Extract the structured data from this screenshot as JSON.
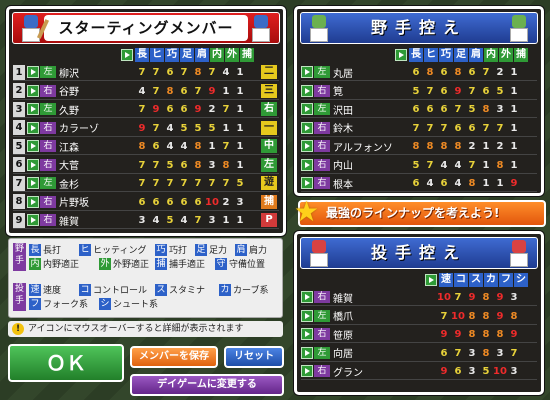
{
  "starting": {
    "title": "スターティングメンバー",
    "categories": [
      "長",
      "ヒ",
      "巧",
      "足",
      "肩",
      "内",
      "外",
      "捕"
    ],
    "players": [
      {
        "num": "1",
        "hand": "左",
        "name": "柳沢",
        "stats": [
          "7",
          "7",
          "6",
          "7",
          "8",
          "7",
          "4",
          "1"
        ],
        "pos": "二"
      },
      {
        "num": "2",
        "hand": "右",
        "name": "谷野",
        "stats": [
          "4",
          "7",
          "8",
          "6",
          "7",
          "9",
          "1",
          "1"
        ],
        "pos": "三"
      },
      {
        "num": "3",
        "hand": "左",
        "name": "久野",
        "stats": [
          "7",
          "9",
          "6",
          "6",
          "9",
          "2",
          "7",
          "1"
        ],
        "pos": "右"
      },
      {
        "num": "4",
        "hand": "右",
        "name": "カラーゾ",
        "stats": [
          "9",
          "7",
          "4",
          "5",
          "5",
          "5",
          "1",
          "1"
        ],
        "pos": "一"
      },
      {
        "num": "5",
        "hand": "右",
        "name": "江森",
        "stats": [
          "8",
          "6",
          "4",
          "4",
          "8",
          "1",
          "7",
          "1"
        ],
        "pos": "中"
      },
      {
        "num": "6",
        "hand": "右",
        "name": "大菅",
        "stats": [
          "7",
          "7",
          "5",
          "6",
          "8",
          "3",
          "8",
          "1"
        ],
        "pos": "左"
      },
      {
        "num": "7",
        "hand": "左",
        "name": "金杉",
        "stats": [
          "7",
          "7",
          "7",
          "7",
          "7",
          "7",
          "7",
          "5"
        ],
        "pos": "遊"
      },
      {
        "num": "8",
        "hand": "右",
        "name": "片野坂",
        "stats": [
          "6",
          "6",
          "6",
          "6",
          "6",
          "10",
          "2",
          "3"
        ],
        "pos": "捕"
      },
      {
        "num": "9",
        "hand": "右",
        "name": "雑賀",
        "stats": [
          "3",
          "4",
          "5",
          "4",
          "7",
          "3",
          "1",
          "1"
        ],
        "pos": "P"
      }
    ]
  },
  "bench": {
    "title": "野手控え",
    "categories": [
      "長",
      "ヒ",
      "巧",
      "足",
      "肩",
      "内",
      "外",
      "捕"
    ],
    "players": [
      {
        "hand": "左",
        "name": "丸居",
        "stats": [
          "6",
          "8",
          "6",
          "8",
          "6",
          "7",
          "2",
          "1"
        ]
      },
      {
        "hand": "右",
        "name": "筧",
        "stats": [
          "5",
          "7",
          "6",
          "9",
          "7",
          "6",
          "5",
          "1"
        ]
      },
      {
        "hand": "左",
        "name": "沢田",
        "stats": [
          "6",
          "6",
          "6",
          "7",
          "5",
          "8",
          "3",
          "1"
        ]
      },
      {
        "hand": "右",
        "name": "鈴木",
        "stats": [
          "7",
          "7",
          "7",
          "6",
          "6",
          "7",
          "7",
          "1"
        ]
      },
      {
        "hand": "右",
        "name": "アルフォンソ",
        "stats": [
          "8",
          "8",
          "8",
          "8",
          "2",
          "1",
          "2",
          "1"
        ]
      },
      {
        "hand": "右",
        "name": "内山",
        "stats": [
          "5",
          "7",
          "4",
          "4",
          "7",
          "1",
          "8",
          "1"
        ]
      },
      {
        "hand": "右",
        "name": "根本",
        "stats": [
          "6",
          "4",
          "6",
          "4",
          "8",
          "1",
          "1",
          "9"
        ]
      }
    ]
  },
  "banner": "最強のラインナップを考えよう!",
  "pitchers": {
    "title": "投手控え",
    "categories": [
      "速",
      "コ",
      "ス",
      "カ",
      "フ",
      "シ"
    ],
    "players": [
      {
        "hand": "右",
        "name": "雑賀",
        "stats": [
          "10",
          "7",
          "9",
          "8",
          "9",
          "3"
        ]
      },
      {
        "hand": "左",
        "name": "橋爪",
        "stats": [
          "7",
          "10",
          "8",
          "8",
          "9",
          "8"
        ]
      },
      {
        "hand": "右",
        "name": "笹原",
        "stats": [
          "9",
          "9",
          "8",
          "8",
          "8",
          "9"
        ]
      },
      {
        "hand": "左",
        "name": "向居",
        "stats": [
          "6",
          "7",
          "3",
          "8",
          "3",
          "7"
        ]
      },
      {
        "hand": "右",
        "name": "グラン",
        "stats": [
          "9",
          "6",
          "3",
          "5",
          "10",
          "3"
        ]
      }
    ]
  },
  "legend": {
    "fielder_tag": "野手",
    "pitcher_tag": "投手",
    "fielder_items": [
      {
        "k": "長",
        "t": "長打",
        "c": "blue"
      },
      {
        "k": "ヒ",
        "t": "ヒッティング",
        "c": "blue"
      },
      {
        "k": "巧",
        "t": "巧打",
        "c": "blue"
      },
      {
        "k": "足",
        "t": "足力",
        "c": "blue"
      },
      {
        "k": "肩",
        "t": "肩力",
        "c": "blue"
      },
      {
        "k": "内",
        "t": "内野適正",
        "c": "blue"
      },
      {
        "k": "外",
        "t": "外野適正",
        "c": "blue"
      },
      {
        "k": "捕",
        "t": "捕手適正",
        "c": "blue"
      },
      {
        "k": "守",
        "t": "守備位置",
        "c": "blue"
      }
    ],
    "pitcher_items": [
      {
        "k": "速",
        "t": "速度",
        "c": "blue"
      },
      {
        "k": "コ",
        "t": "コントロール",
        "c": "blue"
      },
      {
        "k": "ス",
        "t": "スタミナ",
        "c": "blue"
      },
      {
        "k": "カ",
        "t": "カーブ系",
        "c": "blue"
      },
      {
        "k": "フ",
        "t": "フォーク系",
        "c": "blue"
      },
      {
        "k": "シ",
        "t": "シュート系",
        "c": "blue"
      }
    ]
  },
  "hint": "アイコンにマウスオーバーすると詳細が表示されます",
  "hint_mark": "!",
  "buttons": {
    "ok": "ＯＫ",
    "save": "メンバーを保存",
    "reset": "リセット",
    "day": "デイゲームに変更する"
  },
  "colors": {
    "accent_red": "#d81a1a",
    "accent_blue": "#2a4fb0",
    "ok_green": "#2f9a36",
    "save_orange": "#ee7a1c",
    "reset_blue": "#2d61c8",
    "day_purple": "#7e3aa0"
  }
}
